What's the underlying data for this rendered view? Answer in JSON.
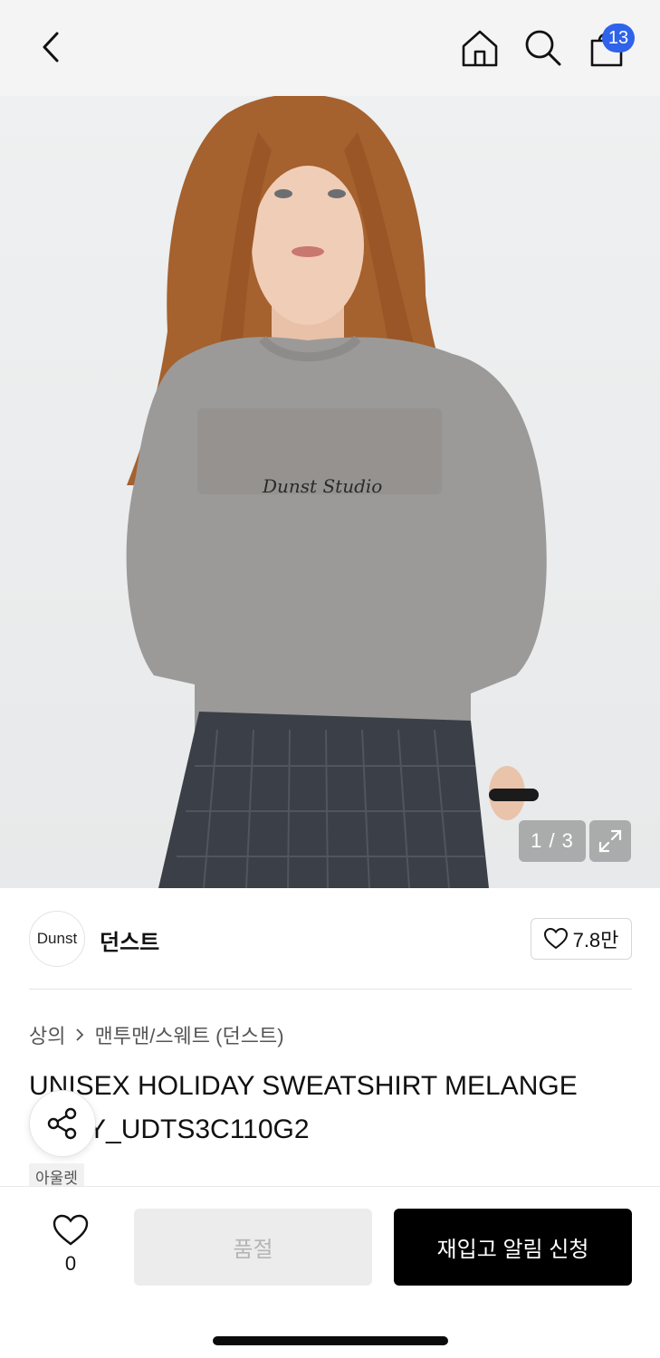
{
  "header": {
    "cart_count": "13"
  },
  "gallery": {
    "counter": "1 / 3"
  },
  "brand": {
    "logo_text": "Dunst",
    "name": "던스트",
    "like_count": "7.8만"
  },
  "breadcrumb": {
    "category": "상의",
    "subcategory": "맨투맨/스웨트 (던스트)"
  },
  "product": {
    "title": "UNISEX HOLIDAY SWEATSHIRT MELANGE GREY_UDTS3C110G2",
    "tag": "아울렛"
  },
  "bottom_bar": {
    "wish_count": "0",
    "soldout_label": "품절",
    "restock_label": "재입고 알림 신청"
  },
  "colors": {
    "badge": "#2f63ea",
    "primary_button": "#000000",
    "disabled_button": "#ececec",
    "sweatshirt": "#9c9a98",
    "hair": "#a5612e",
    "skirt": "#3b3f47"
  }
}
